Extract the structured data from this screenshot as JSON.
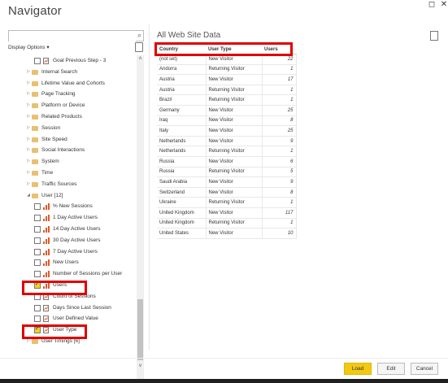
{
  "window": {
    "title": "Navigator",
    "restore_glyph": "◻",
    "close_glyph": "✕"
  },
  "left": {
    "search": {
      "placeholder": "",
      "value": ""
    },
    "display_options_label": "Display Options ▾",
    "tree": [
      {
        "label": "Goal Previous Step - 3",
        "kind": "field",
        "indent": 2,
        "checked": false
      },
      {
        "label": "Internal Search",
        "kind": "folder",
        "indent": 1
      },
      {
        "label": "Lifetime Value and Cohorts",
        "kind": "folder",
        "indent": 1
      },
      {
        "label": "Page Tracking",
        "kind": "folder",
        "indent": 1
      },
      {
        "label": "Platform or Device",
        "kind": "folder",
        "indent": 1
      },
      {
        "label": "Related Products",
        "kind": "folder",
        "indent": 1
      },
      {
        "label": "Session",
        "kind": "folder",
        "indent": 1
      },
      {
        "label": "Site Speed",
        "kind": "folder",
        "indent": 1
      },
      {
        "label": "Social Interactions",
        "kind": "folder",
        "indent": 1
      },
      {
        "label": "System",
        "kind": "folder",
        "indent": 1
      },
      {
        "label": "Time",
        "kind": "folder",
        "indent": 1
      },
      {
        "label": "Traffic Sources",
        "kind": "folder",
        "indent": 1
      },
      {
        "label": "User [12]",
        "kind": "folder-open",
        "indent": 1
      },
      {
        "label": "% New Sessions",
        "kind": "measure",
        "indent": 2,
        "checked": false
      },
      {
        "label": "1 Day Active Users",
        "kind": "measure",
        "indent": 2,
        "checked": false
      },
      {
        "label": "14 Day Active Users",
        "kind": "measure",
        "indent": 2,
        "checked": false
      },
      {
        "label": "30 Day Active Users",
        "kind": "measure",
        "indent": 2,
        "checked": false
      },
      {
        "label": "7 Day Active Users",
        "kind": "measure",
        "indent": 2,
        "checked": false
      },
      {
        "label": "New Users",
        "kind": "measure",
        "indent": 2,
        "checked": false
      },
      {
        "label": "Number of Sessions per User",
        "kind": "measure",
        "indent": 2,
        "checked": false
      },
      {
        "label": "Users",
        "kind": "measure",
        "indent": 2,
        "checked": true
      },
      {
        "label": "Count of Sessions",
        "kind": "field",
        "indent": 2,
        "checked": false
      },
      {
        "label": "Days Since Last Session",
        "kind": "field",
        "indent": 2,
        "checked": false
      },
      {
        "label": "User Defined Value",
        "kind": "field",
        "indent": 2,
        "checked": false
      },
      {
        "label": "User Type",
        "kind": "field",
        "indent": 2,
        "checked": true
      },
      {
        "label": "User Timings [6]",
        "kind": "folder",
        "indent": 1
      }
    ]
  },
  "preview": {
    "title": "All Web Site Data",
    "columns": [
      "Country",
      "User Type",
      "Users"
    ],
    "rows": [
      [
        "(not set)",
        "New Visitor",
        "22"
      ],
      [
        "Andorra",
        "Returning Visitor",
        "1"
      ],
      [
        "Austria",
        "New Visitor",
        "17"
      ],
      [
        "Austria",
        "Returning Visitor",
        "1"
      ],
      [
        "Brazil",
        "Returning Visitor",
        "1"
      ],
      [
        "Germany",
        "New Visitor",
        "25"
      ],
      [
        "Iraq",
        "New Visitor",
        "8"
      ],
      [
        "Italy",
        "New Visitor",
        "25"
      ],
      [
        "Netherlands",
        "New Visitor",
        "9"
      ],
      [
        "Netherlands",
        "Returning Visitor",
        "1"
      ],
      [
        "Russia",
        "New Visitor",
        "6"
      ],
      [
        "Russia",
        "Returning Visitor",
        "5"
      ],
      [
        "Saudi Arabia",
        "New Visitor",
        "9"
      ],
      [
        "Switzerland",
        "New Visitor",
        "8"
      ],
      [
        "Ukraine",
        "Returning Visitor",
        "1"
      ],
      [
        "United Kingdom",
        "New Visitor",
        "117"
      ],
      [
        "United Kingdom",
        "Returning Visitor",
        "1"
      ],
      [
        "United States",
        "New Visitor",
        "10"
      ]
    ]
  },
  "footer": {
    "load_label": "Load",
    "edit_label": "Edit",
    "cancel_label": "Cancel"
  },
  "colors": {
    "accent": "#f2c811",
    "highlight": "#e00000",
    "measure_icon": "#e05a2a",
    "folder": "#e8c070"
  }
}
